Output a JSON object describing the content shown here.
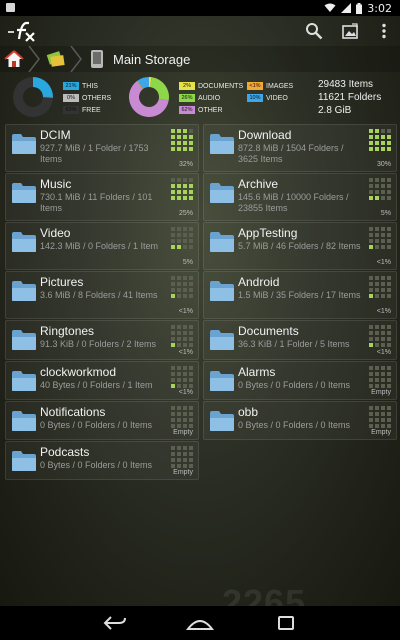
{
  "status": {
    "time": "3:02"
  },
  "action_bar": {
    "app_icon": "fx-logo",
    "icons": [
      "search-icon",
      "gallery-icon",
      "overflow-icon"
    ]
  },
  "breadcrumb": {
    "icons": [
      "home-icon",
      "apps-icon",
      "phone-storage-icon"
    ],
    "current": "Main Storage"
  },
  "usage": {
    "left_chart": [
      {
        "pct": "21%",
        "label": "THIS",
        "color": "#29a8e0"
      },
      {
        "pct": "0%",
        "label": "OTHERS",
        "color": "#bbbbbb"
      },
      {
        "pct": "63%",
        "label": "FREE",
        "color": "#333333"
      }
    ],
    "right_chart": [
      {
        "pct": "2%",
        "label": "DOCUMENTS",
        "color": "#e6e24a"
      },
      {
        "pct": "26%",
        "label": "AUDIO",
        "color": "#8ed64a"
      },
      {
        "pct": "62%",
        "label": "OTHER",
        "color": "#c98ad4"
      },
      {
        "pct": "<1%",
        "label": "IMAGES",
        "color": "#f2a736"
      },
      {
        "pct": "10%",
        "label": "VIDEO",
        "color": "#3fa7e8"
      }
    ],
    "totals": {
      "items": "29483 Items",
      "folders": "11621 Folders",
      "size": "2.8 GiB"
    }
  },
  "folders": [
    {
      "name": "DCIM",
      "detail": "927.7 MiB / 1 Folder / 1753 Items",
      "pct": "32%",
      "fill": 0.32
    },
    {
      "name": "Download",
      "detail": "872.8 MiB / 1504 Folders / 3625 Items",
      "pct": "30%",
      "fill": 0.3
    },
    {
      "name": "Music",
      "detail": "730.1 MiB / 11 Folders / 101 Items",
      "pct": "25%",
      "fill": 0.25
    },
    {
      "name": "Archive",
      "detail": "145.6 MiB / 10000 Folders / 23855 Items",
      "pct": "5%",
      "fill": 0.05
    },
    {
      "name": "Video",
      "detail": "142.3 MiB / 0 Folders / 1 Item",
      "pct": "5%",
      "fill": 0.05
    },
    {
      "name": "AppTesting",
      "detail": "5.7 MiB / 46 Folders / 82 Items",
      "pct": "<1%",
      "fill": 0.01
    },
    {
      "name": "Pictures",
      "detail": "3.6 MiB / 8 Folders / 41 Items",
      "pct": "<1%",
      "fill": 0.01
    },
    {
      "name": "Android",
      "detail": "1.5 MiB / 35 Folders / 17 Items",
      "pct": "<1%",
      "fill": 0.01
    },
    {
      "name": "Ringtones",
      "detail": "91.3 KiB / 0 Folders / 2 Items",
      "pct": "<1%",
      "fill": 0.01
    },
    {
      "name": "Documents",
      "detail": "36.3 KiB / 1 Folder / 5 Items",
      "pct": "<1%",
      "fill": 0.01
    },
    {
      "name": "clockworkmod",
      "detail": "40 Bytes / 0 Folders / 1 Item",
      "pct": "<1%",
      "fill": 0.01
    },
    {
      "name": "Alarms",
      "detail": "0 Bytes / 0 Folders / 0 Items",
      "pct": "Empty",
      "fill": 0
    },
    {
      "name": "Notifications",
      "detail": "0 Bytes / 0 Folders / 0 Items",
      "pct": "Empty",
      "fill": 0
    },
    {
      "name": "obb",
      "detail": "0 Bytes / 0 Folders / 0 Items",
      "pct": "Empty",
      "fill": 0
    },
    {
      "name": "Podcasts",
      "detail": "0 Bytes / 0 Folders / 0 Items",
      "pct": "Empty",
      "fill": 0
    }
  ],
  "nav": {
    "icons": [
      "back-icon",
      "home-icon",
      "recents-icon"
    ]
  },
  "watermark": "2265"
}
